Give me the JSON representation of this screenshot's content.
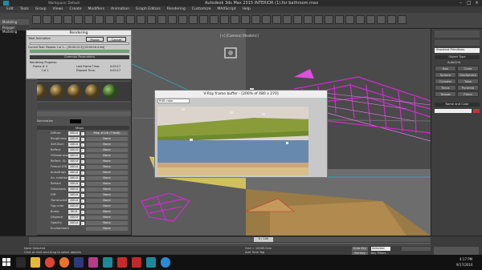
{
  "window": {
    "title": "Autodesk 3ds Max 2015    INTERIOR (1).for bathroom.max",
    "workspace": "Workspace: Default"
  },
  "menu": [
    "Edit",
    "Tools",
    "Group",
    "Views",
    "Create",
    "Modifiers",
    "Animation",
    "Graph Editors",
    "Rendering",
    "Customize",
    "MAXScript",
    "Help"
  ],
  "left_tabs": [
    "Modeling",
    "Polygon Modeling"
  ],
  "rendering": {
    "title": "Rendering",
    "pause": "Pause",
    "cancel": "Cancel",
    "total_animation": "Total Animation",
    "current_task": "Current Task: Prepass 1 of 1... [00:00:15.3] [00:00:16.4 est]",
    "common_params": "Common Parameters",
    "rendering_progress": "Rendering Progress:",
    "frame_label": "Frame #",
    "frame_val": "0",
    "of_label": "1 of 1",
    "last_time_label": "Last Frame Time:",
    "last_time": "0:00:17",
    "elapsed_label": "Elapsed Time:",
    "elapsed": "0:00:17"
  },
  "mat": {
    "self_illum": "Self-Illumination",
    "maps_header": "Maps",
    "map_col": "Map #126  (Tiles8)",
    "row_names": [
      "Diffuse",
      "Roughness",
      "Self-illum",
      "Reflect",
      "HGlossiness",
      "Reflect. Gl.",
      "Fresnel IOR",
      "Anisotropy",
      "An. rotation",
      "Refract",
      "Glossiness",
      "IOR",
      "Translucent",
      "Fog color",
      "Bump",
      "Displace",
      "Opacity",
      "Environment"
    ],
    "row_vals": [
      "100.0",
      "100.0",
      "100.0",
      "100.0",
      "100.0",
      "100.0",
      "100.0",
      "100.0",
      "100.0",
      "100.0",
      "100.0",
      "100.0",
      "100.0",
      "100.0",
      "30.0",
      "100.0",
      "100.0",
      ""
    ],
    "none": "None",
    "reflect_ies": "Reflect In IES"
  },
  "vfb": {
    "title": "V-Ray frame buffer - [200% of 480 x 270]",
    "channel": "RGB color"
  },
  "rightpanel": {
    "dropdown": "Standard Primitives",
    "object_type": "Object Type",
    "autogrid": "AutoGrid",
    "buttons": [
      "Box",
      "Cone",
      "Sphere",
      "GeoSphere",
      "Cylinder",
      "Tube",
      "Torus",
      "Pyramid",
      "Teapot",
      "Plane"
    ],
    "name_color": "Name and Color"
  },
  "status": {
    "selected": "None Selected",
    "hint": "Click or click-and-drag to select objects",
    "timeline": "0 / 100",
    "grid": "Grid = 10000.0cm",
    "add_time_tag": "Add Time Tag",
    "autokey": "Auto Key",
    "selected_drop": "Selected",
    "set_key": "Set Key",
    "key_filters": "Key Filters...",
    "frame": "0",
    "x": "",
    "y": "",
    "z": ""
  },
  "taskbar": {
    "time": "4:17 PM",
    "date": "9/17/2016",
    "apps": [
      "start",
      "search",
      "folder",
      "chrome",
      "firefox",
      "photoshop",
      "indesign",
      "3dsmax",
      "acrobat",
      "autocad",
      "3dsmax2",
      "skype",
      "other"
    ]
  },
  "colors": {
    "accent": "#46c24a",
    "magenta": "#d22ad2",
    "wireframe_pink": "#e47ae8",
    "yellow_line": "#e8e05a"
  }
}
